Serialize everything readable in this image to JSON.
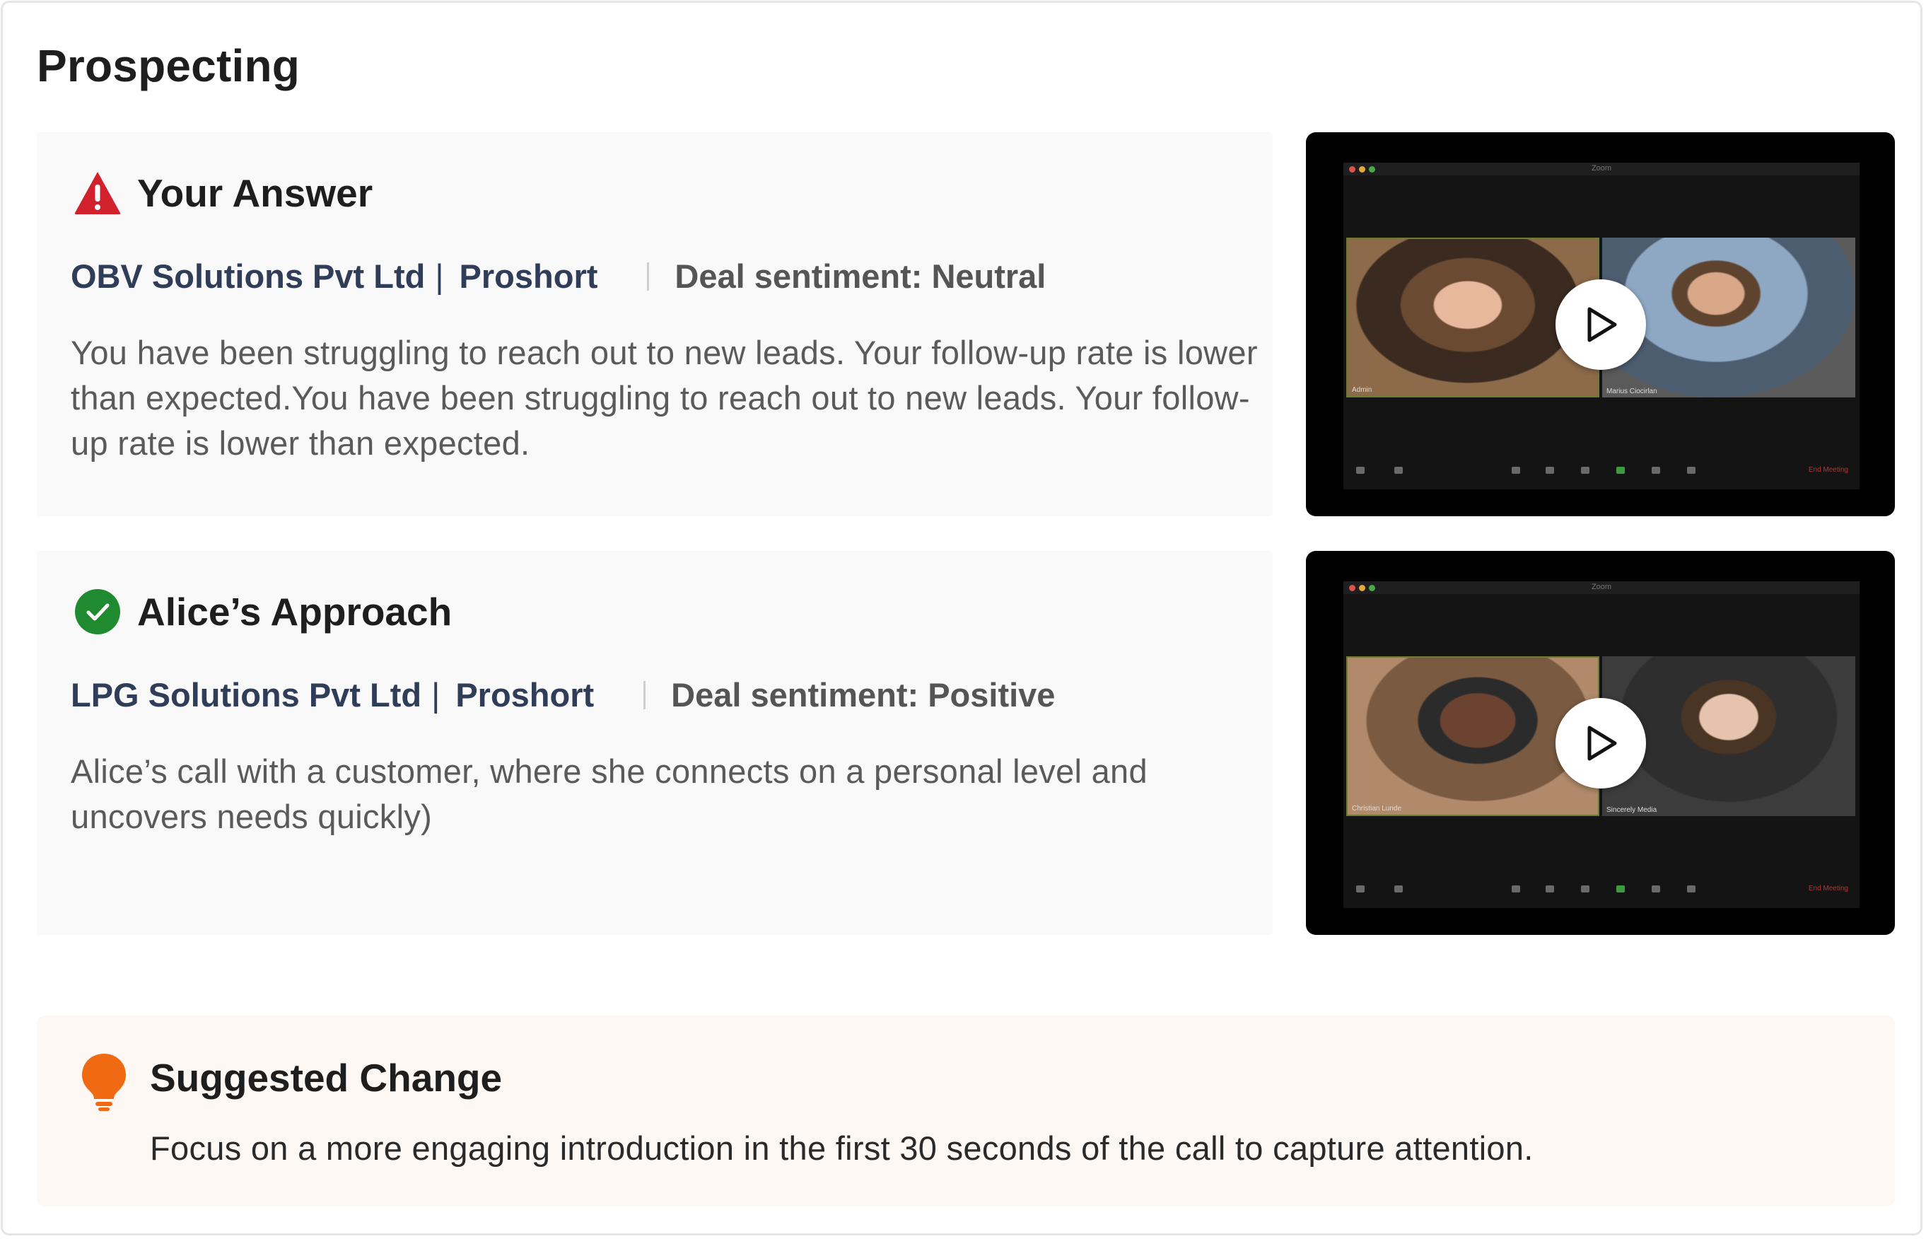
{
  "page": {
    "title": "Prospecting"
  },
  "your_answer": {
    "title": "Your Answer",
    "company": "OBV Solutions Pvt Ltd",
    "product": "Proshort",
    "sentiment": "Deal sentiment: Neutral",
    "description": "You have been struggling to reach out to new leads. Your follow-up rate is lower than expected.You have been struggling to reach out to new leads. Your follow-up rate is lower than expected.",
    "video": {
      "app_title": "Zoom",
      "participant_left": "Admin",
      "participant_right": "Marius Ciocirlan",
      "end_label": "End Meeting"
    }
  },
  "alice_approach": {
    "title": "Alice’s Approach",
    "company": "LPG Solutions Pvt Ltd",
    "product": "Proshort",
    "sentiment": "Deal sentiment: Positive",
    "description": "Alice’s call with a customer, where she connects on a personal level and uncovers needs quickly)",
    "video": {
      "app_title": "Zoom",
      "participant_left": "Christian Lunde",
      "participant_right": "Sincerely Media",
      "end_label": "End Meeting"
    }
  },
  "suggested_change": {
    "title": "Suggested Change",
    "body": "Focus on a more engaging introduction in the first 30 seconds of the call to capture attention."
  },
  "icons": {
    "warning": "warning-triangle-icon",
    "success": "check-circle-icon",
    "tip": "lightbulb-icon",
    "play": "play-icon"
  },
  "colors": {
    "warning": "#d0212d",
    "success": "#1f8a2f",
    "tip": "#f06a14",
    "company_text": "#2f3d58",
    "panel_bg": "#f9f9f9",
    "suggest_bg": "#fdf8f4"
  }
}
